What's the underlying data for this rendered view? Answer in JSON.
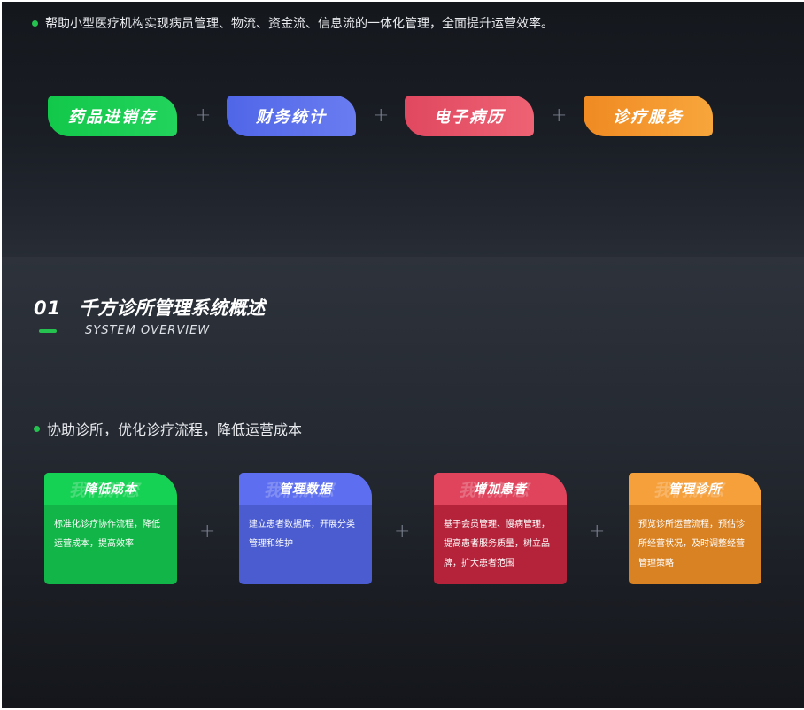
{
  "top": {
    "intro": "帮助小型医疗机构实现病员管理、物流、资金流、信息流的一体化管理，全面提升运营效率。",
    "features": [
      {
        "label": "药品进销存",
        "color": "#1ccf55"
      },
      {
        "label": "财务统计",
        "color": "#5a6fee"
      },
      {
        "label": "电子病历",
        "color": "#e7536a"
      },
      {
        "label": "诊疗服务",
        "color": "#f49a30"
      }
    ]
  },
  "section": {
    "number": "01",
    "title": "千方诊所管理系统概述",
    "subtitle": "SYSTEM OVERVIEW",
    "accent_color": "#25c24f",
    "intro": "协助诊所，优化诊疗流程，降低运营成本"
  },
  "cards": [
    {
      "watermark": "我们解您",
      "title": "降低成本",
      "body": "标准化诊疗协作流程，降低运营成本，提高效率",
      "color": "#12b547"
    },
    {
      "watermark": "我们解您",
      "title": "管理数据",
      "body": "建立患者数据库，开展分类管理和维护",
      "color": "#4a5cd0"
    },
    {
      "watermark": "我们解您",
      "title": "增加患者",
      "body": "基于会员管理、慢病管理，提高患者服务质量，树立品牌，扩大患者范围",
      "color": "#b5233a"
    },
    {
      "watermark": "我们解您",
      "title": "管理诊所",
      "body": "预览诊所运营流程，预估诊所经营状况，及时调整经营管理策略",
      "color": "#d98224"
    }
  ],
  "icons": {
    "bullet": "green-dot-icon",
    "joiner": "plus-icon",
    "joiner_glyph": "+"
  }
}
